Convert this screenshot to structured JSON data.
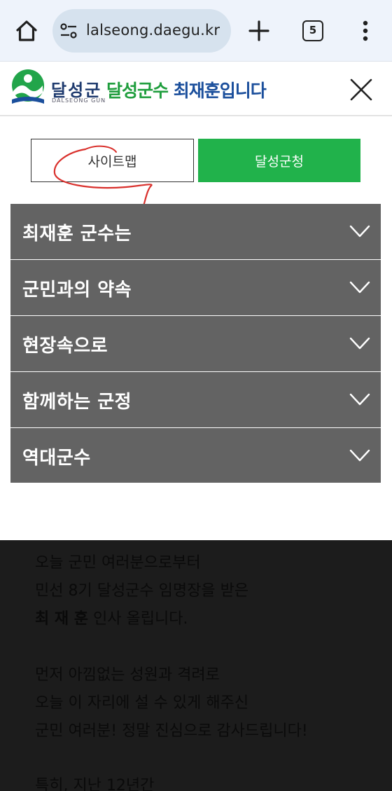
{
  "browser": {
    "url": "lalseong.daegu.kr",
    "tab_count": "5"
  },
  "header": {
    "logo_name": "달성군",
    "logo_eng": "DALSEONG GUN",
    "slogan_green": "달성군수",
    "slogan_blue": "최재훈입니다"
  },
  "tabs": {
    "sitemap_label": "사이트맵",
    "office_label": "달성군청"
  },
  "menu": {
    "items": [
      {
        "label": "최재훈 군수는"
      },
      {
        "label": "군민과의 약속"
      },
      {
        "label": "현장속으로"
      },
      {
        "label": "함께하는 군정"
      },
      {
        "label": "역대군수"
      }
    ]
  },
  "background_text": {
    "lines": [
      "오늘 군민 여러분으로부터",
      "민선 8기 달성군수 임명장을 받은",
      "인사 올립니다.",
      "먼저 아낌없는 성원과 격려로",
      "오늘 이 자리에 설 수 있게 해주신",
      "군민 여러분! 정말 진심으로 감사드립니다!",
      "특히, 지난 12년간"
    ],
    "bold_name": "최 재 훈"
  },
  "colors": {
    "browser_bg": "#eef3fb",
    "url_pill": "#d6e2ee",
    "menu_bg": "#636363",
    "office_button": "#21b24b",
    "slogan_green": "#1f9e3d",
    "slogan_blue": "#1b4f9c",
    "overlay": "#1c1c1c",
    "annotation": "#d9302c"
  },
  "icons": [
    "home-icon",
    "site-info-icon",
    "new-tab-icon",
    "tab-switcher-icon",
    "more-menu-icon",
    "dalseong-logo",
    "close-icon",
    "chevron-down-icon"
  ]
}
